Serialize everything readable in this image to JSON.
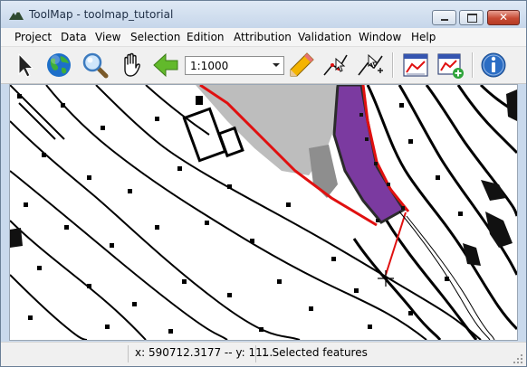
{
  "window": {
    "title": "ToolMap - toolmap_tutorial"
  },
  "menu": [
    "Project",
    "Data",
    "View",
    "Selection",
    "Edition",
    "Attribution",
    "Validation",
    "Window",
    "Help"
  ],
  "toolbar": {
    "scale_value": "1:1000",
    "icons": [
      "select-arrow-icon",
      "globe-icon",
      "zoom-icon",
      "pan-hand-icon",
      "back-arrow-icon",
      "pencil-icon",
      "edit-vertex-icon",
      "modify-line-icon",
      "attribution-icon",
      "add-attribution-icon",
      "info-icon"
    ]
  },
  "status": {
    "coordinates": "x: 590712.3177 -- y: 11...",
    "selection": "1 Selected features"
  },
  "colors": {
    "selection_red": "#e01010",
    "polygon_purple": "#7b3aa0",
    "contour_black": "#000000",
    "relief_gray": "#bcbcbc"
  }
}
